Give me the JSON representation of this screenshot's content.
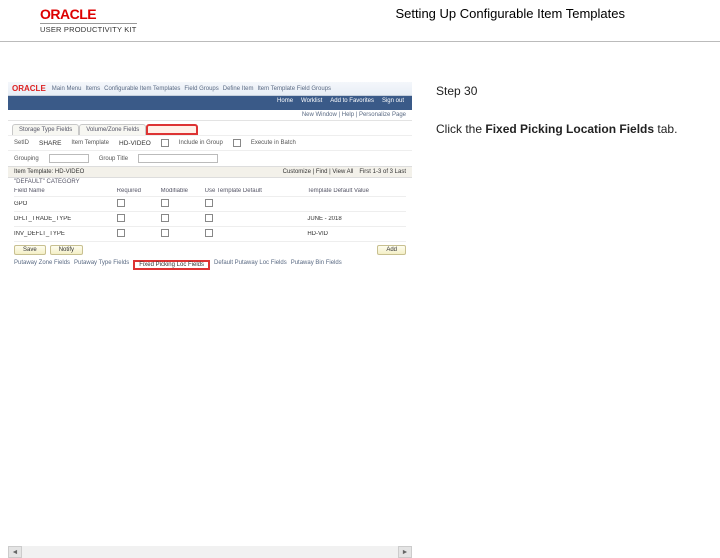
{
  "header": {
    "brand": "ORACLE",
    "subbrand": "USER PRODUCTIVITY KIT",
    "title": "Setting Up Configurable Item Templates"
  },
  "side": {
    "step": "Step 30",
    "instr_prefix": "Click the ",
    "instr_bold": "Fixed Picking Location Fields",
    "instr_suffix": " tab."
  },
  "app": {
    "brand": "ORACLE",
    "crumbs": [
      "Main Menu",
      "Items",
      "Configurable Item Templates",
      "Field Groups",
      "Define Item",
      "Item Template Field Groups"
    ],
    "menu": [
      "Home",
      "Worklist",
      "Add to Favorites",
      "Sign out"
    ],
    "linkrow": "New Window | Help | Personalize Page",
    "toptabs": [
      "Storage Type Fields",
      "Volume/Zone Fields"
    ],
    "form": {
      "setid_lbl": "SetID",
      "setid_val": "SHARE",
      "tmpl_lbl": "Item Template",
      "tmpl_val": "HD-VIDEO",
      "incg_lbl": "Include in Group",
      "batch_lbl": "Execute in Batch"
    },
    "group": {
      "title": "Item Template: HD-VIDEO",
      "subtitle": "\"DEFAULT\" CATEGORY",
      "custom_lbl": "Customize | Find | View All",
      "first_lbl": "First 1-3 of 3 Last"
    },
    "gridhead": [
      "Field Name",
      "Required",
      "Modifiable",
      "Use Template Default",
      "Template Default Value"
    ],
    "rows": [
      [
        "GPO",
        "",
        "",
        "",
        ""
      ],
      [
        "DFLT_TRADE_TYPE",
        "",
        "",
        "",
        "JUNE - 2018"
      ],
      [
        "INV_DEFLT_TYPE",
        "",
        "",
        "",
        "HD-VID"
      ]
    ],
    "buttons": {
      "save": "Save",
      "notify": "Notify",
      "add": "Add"
    },
    "subtabs": [
      "Putaway Zone Fields",
      "Putaway Type Fields",
      "Fixed Picking Loc Fields",
      "Default Putaway Loc Fields",
      "Putaway Bin Fields"
    ]
  }
}
